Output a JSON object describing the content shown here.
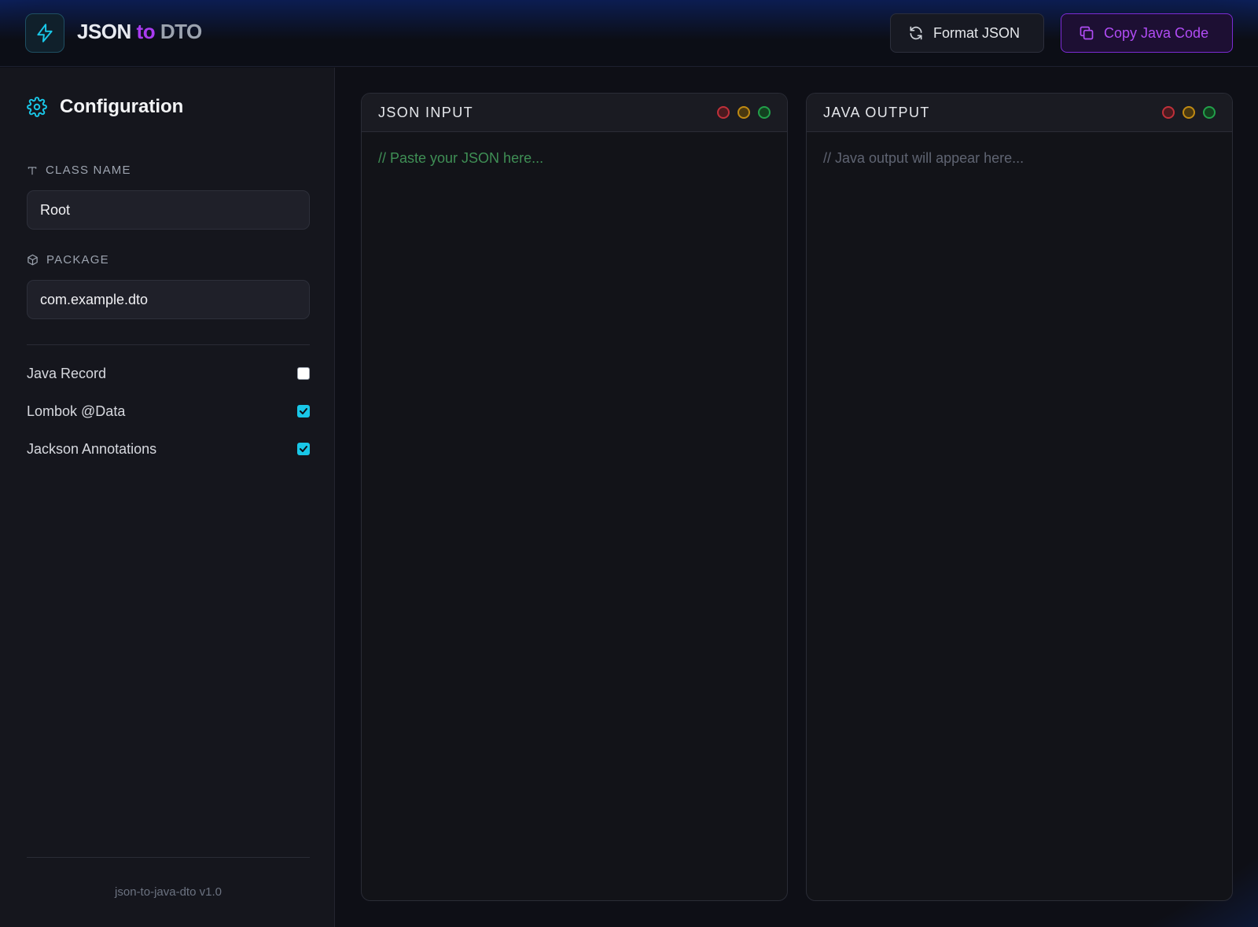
{
  "header": {
    "brand": {
      "part1": "JSON",
      "part2": "to",
      "part3": "DTO"
    },
    "format_button": "Format JSON",
    "copy_button": "Copy Java Code"
  },
  "sidebar": {
    "title": "Configuration",
    "class_name": {
      "label": "CLASS NAME",
      "value": "Root"
    },
    "package": {
      "label": "PACKAGE",
      "value": "com.example.dto"
    },
    "options": [
      {
        "label": "Java Record",
        "checked": false
      },
      {
        "label": "Lombok @Data",
        "checked": true
      },
      {
        "label": "Jackson Annotations",
        "checked": true
      }
    ],
    "footer": "json-to-java-dto v1.0"
  },
  "panels": {
    "input": {
      "title": "JSON INPUT",
      "placeholder": "// Paste your JSON here..."
    },
    "output": {
      "title": "JAVA OUTPUT",
      "placeholder": "// Java output will appear here..."
    }
  },
  "colors": {
    "accent_cyan": "#19c7e8",
    "accent_purple": "#a93bf0",
    "background": "#0e0f16"
  }
}
